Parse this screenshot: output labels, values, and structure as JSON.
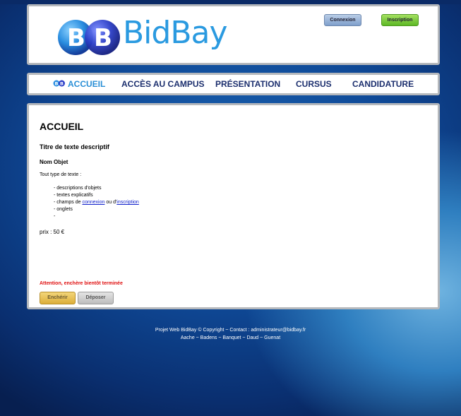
{
  "header": {
    "brand": "BidBay",
    "connexion_label": "Connexion",
    "inscription_label": "Inscription"
  },
  "nav": {
    "items": [
      {
        "label": "ACCUEIL",
        "active": true
      },
      {
        "label": "ACCÈS AU CAMPUS",
        "active": false
      },
      {
        "label": "PRÉSENTATION",
        "active": false
      },
      {
        "label": "CURSUS",
        "active": false
      },
      {
        "label": "CANDIDATURE",
        "active": false
      }
    ]
  },
  "content": {
    "title": "ACCUEIL",
    "subtitle": "Titre de texte descriptif",
    "object_name": "Nom Objet",
    "intro": "Tout type de texte :",
    "list": {
      "item1": "- descriptions d'objets",
      "item2": "- textes explicatifs",
      "item3_prefix": "- champs de ",
      "item3_link1": "connexion",
      "item3_middle": " ou d'",
      "item3_link2": "inscription",
      "item4": "- onglets",
      "item5": "-"
    },
    "price": "prix : 50 €",
    "warning": "Attention, enchère bientôt terminée",
    "bid_button": "Enchérir",
    "deposit_button": "Déposer"
  },
  "footer": {
    "line1": "Projet Web BidBay © Copyright ~ Contact : administrateur@bidbay.fr",
    "line2": "Aache ~ Badens ~ Banquet ~ Daud ~ Guenat"
  },
  "colors": {
    "brand_blue": "#2a9ae0",
    "nav_text": "#1c2f6e",
    "warning": "#e01010",
    "link": "#1122cc"
  }
}
